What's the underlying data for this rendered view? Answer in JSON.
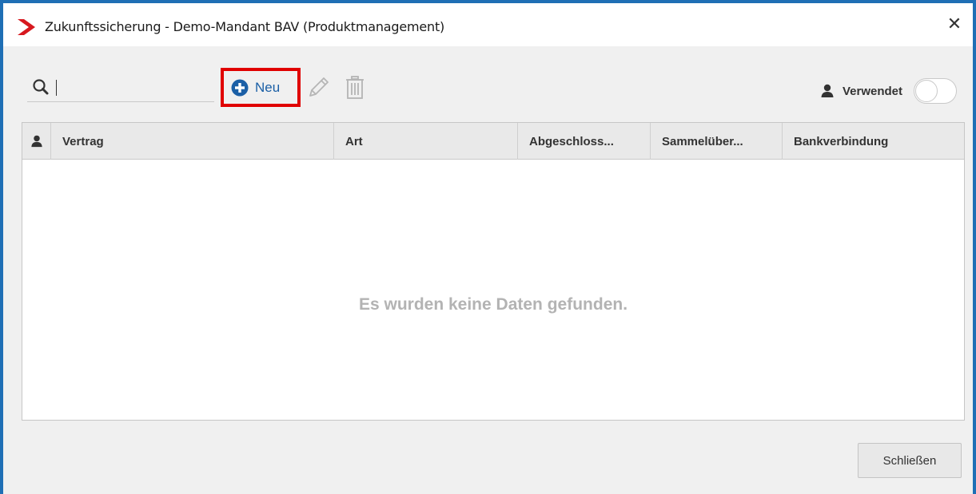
{
  "window": {
    "title": "Zukunftssicherung - Demo-Mandant BAV (Produktmanagement)",
    "close_glyph": "✕",
    "border_color": "#1f6fb5",
    "logo_color": "#d7191f"
  },
  "toolbar": {
    "search": {
      "value": "",
      "placeholder": ""
    },
    "new_label": "Neu",
    "new_icon": "plus-circle-icon",
    "edit_icon": "pencil-icon",
    "delete_icon": "trash-icon",
    "used_label": "Verwendet",
    "used_toggle_on": false,
    "highlight_color": "#e00000",
    "accent_color": "#1b5fa6"
  },
  "grid": {
    "columns": [
      {
        "label": ""
      },
      {
        "label": "Vertrag"
      },
      {
        "label": "Art"
      },
      {
        "label": "Abgeschloss..."
      },
      {
        "label": "Sammelüber..."
      },
      {
        "label": "Bankverbindung"
      }
    ],
    "rows": [],
    "empty_message": "Es wurden keine Daten gefunden."
  },
  "footer": {
    "close_label": "Schließen"
  }
}
